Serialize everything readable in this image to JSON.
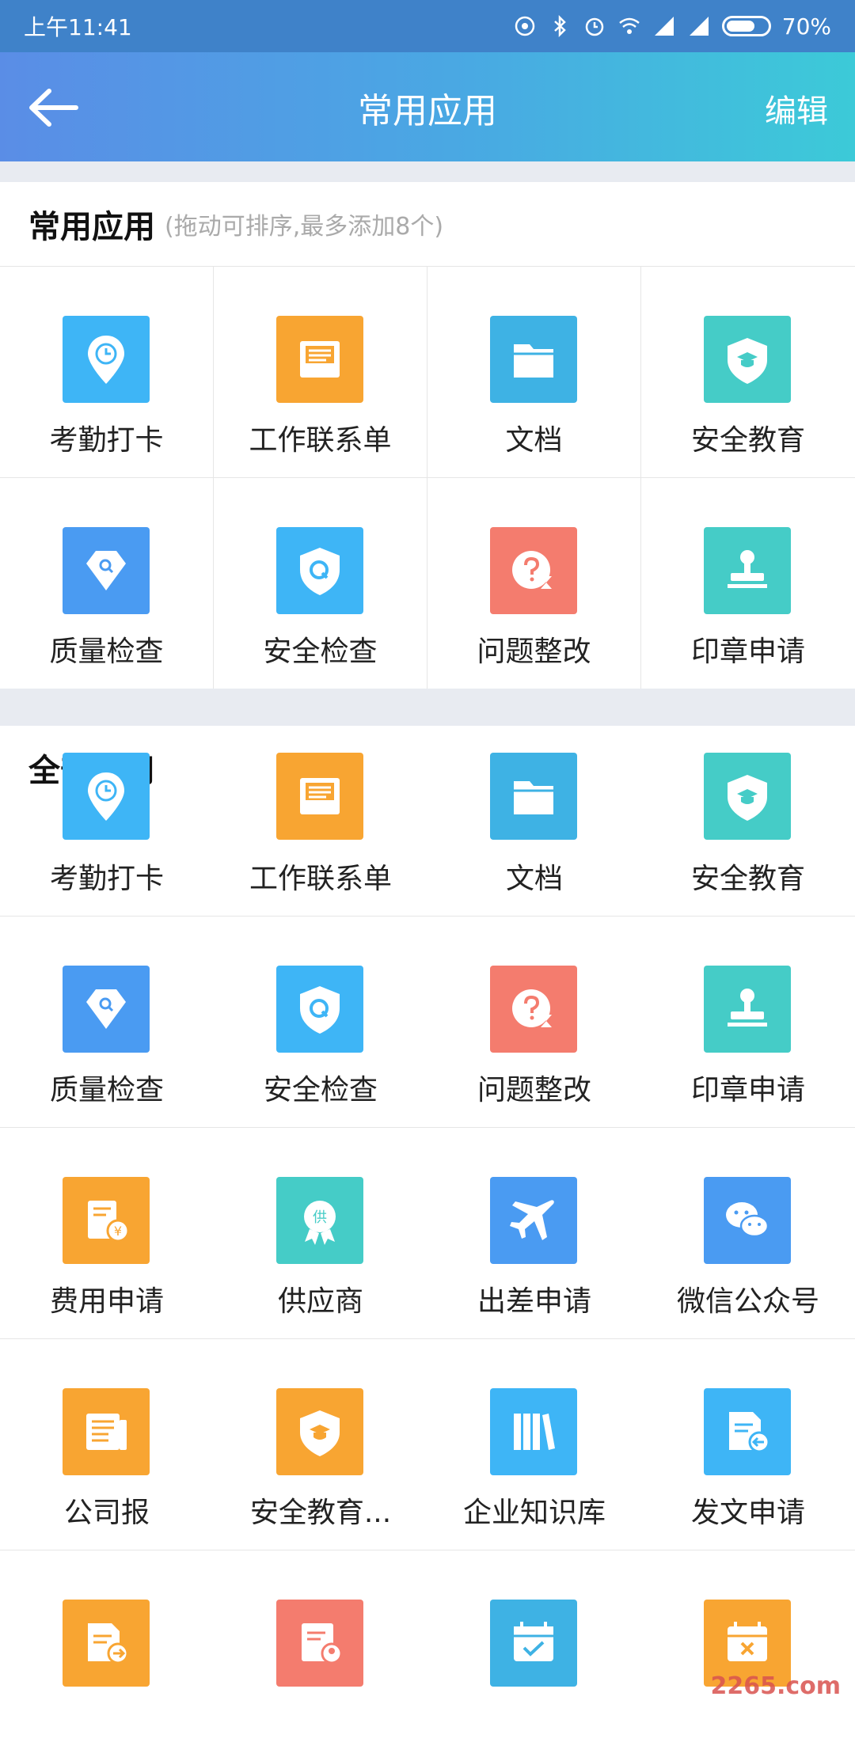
{
  "status_bar": {
    "time": "上午11:41",
    "battery": "70%",
    "battery_level": 0.7
  },
  "header": {
    "title": "常用应用",
    "edit": "编辑"
  },
  "common": {
    "title": "常用应用",
    "hint": "(拖动可排序,最多添加8个)",
    "apps": [
      {
        "label": "考勤打卡",
        "icon": "location-clock-icon",
        "color": "#3eb5f6"
      },
      {
        "label": "工作联系单",
        "icon": "inbox-document-icon",
        "color": "#f8a532"
      },
      {
        "label": "文档",
        "icon": "folder-icon",
        "color": "#3eb2e4"
      },
      {
        "label": "安全教育",
        "icon": "shield-graduation-icon",
        "color": "#45ccc7"
      },
      {
        "label": "质量检查",
        "icon": "gem-search-icon",
        "color": "#4a9bf2"
      },
      {
        "label": "安全检查",
        "icon": "shield-q-icon",
        "color": "#3eb5f6"
      },
      {
        "label": "问题整改",
        "icon": "question-hourglass-icon",
        "color": "#f47c6e"
      },
      {
        "label": "印章申请",
        "icon": "stamp-icon",
        "color": "#45ccc7"
      }
    ]
  },
  "all": {
    "title": "全部应用",
    "partial_row": [
      {
        "label": "考勤打卡",
        "icon": "location-clock-icon",
        "color": "#3eb5f6"
      },
      {
        "label": "工作联系单",
        "icon": "inbox-document-icon",
        "color": "#f8a532"
      },
      {
        "label": "文档",
        "icon": "folder-icon",
        "color": "#3eb2e4"
      },
      {
        "label": "安全教育",
        "icon": "shield-graduation-icon",
        "color": "#45ccc7"
      }
    ],
    "apps": [
      {
        "label": "质量检查",
        "icon": "gem-search-icon",
        "color": "#4a9bf2"
      },
      {
        "label": "安全检查",
        "icon": "shield-q-icon",
        "color": "#3eb5f6"
      },
      {
        "label": "问题整改",
        "icon": "question-hourglass-icon",
        "color": "#f47c6e"
      },
      {
        "label": "印章申请",
        "icon": "stamp-icon",
        "color": "#45ccc7"
      },
      {
        "label": "费用申请",
        "icon": "expense-icon",
        "color": "#f8a532"
      },
      {
        "label": "供应商",
        "icon": "supplier-badge-icon",
        "color": "#45ccc7"
      },
      {
        "label": "出差申请",
        "icon": "airplane-icon",
        "color": "#4a9bf2"
      },
      {
        "label": "微信公众号",
        "icon": "wechat-icon",
        "color": "#4a9bf2"
      },
      {
        "label": "公司报",
        "icon": "newspaper-icon",
        "color": "#f8a532"
      },
      {
        "label": "安全教育...",
        "icon": "shield-graduation-icon",
        "color": "#f8a532"
      },
      {
        "label": "企业知识库",
        "icon": "books-icon",
        "color": "#3eb5f6"
      },
      {
        "label": "发文申请",
        "icon": "document-send-icon",
        "color": "#3eb5f6"
      },
      {
        "label": "",
        "icon": "document-forward-icon",
        "color": "#f8a532"
      },
      {
        "label": "",
        "icon": "document-person-icon",
        "color": "#f47c6e"
      },
      {
        "label": "",
        "icon": "calendar-check-icon",
        "color": "#3eb2e4"
      },
      {
        "label": "",
        "icon": "calendar-cross-icon",
        "color": "#f8a532"
      }
    ]
  },
  "watermark": "2265.com"
}
